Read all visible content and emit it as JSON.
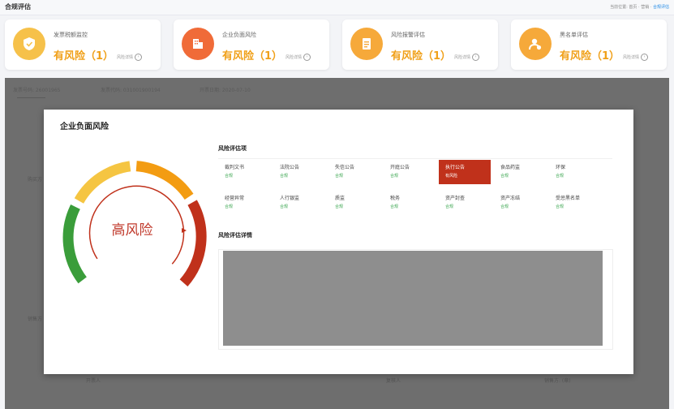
{
  "header": {
    "title": "合规评估",
    "breadcrumb": [
      "当前位置:",
      "首页",
      "·",
      "营销",
      "·",
      "合规评估"
    ]
  },
  "cards": [
    {
      "label": "发票税额监控",
      "status": "有风险（1）",
      "link": "风险详情",
      "color": "#f6c14a"
    },
    {
      "label": "企业负面风险",
      "status": "有风险（1）",
      "link": "风险详情",
      "color": "#f06b38"
    },
    {
      "label": "风险报警评估",
      "status": "有风险（1）",
      "link": "风险详情",
      "color": "#f6a93a"
    },
    {
      "label": "黑名单评估",
      "status": "有风险（1）",
      "link": "风险详情",
      "color": "#f6a93a"
    }
  ],
  "background": {
    "info1": "发票号码: 26001965",
    "info2": "发票代码: 031001900194",
    "info3": "开票日期: 2020-07-10",
    "side_a": "购买方",
    "side_b": "销售方",
    "row1": "开票人",
    "row2": "复核人",
    "row3": "销售方: (章)"
  },
  "modal": {
    "title": "企业负面风险",
    "gauge_label": "高风险",
    "section_items": "风险评估项",
    "section_detail": "风险评估详情",
    "items": [
      {
        "name": "裁判文书",
        "status": "合规",
        "risk": false
      },
      {
        "name": "法院公告",
        "status": "合规",
        "risk": false
      },
      {
        "name": "失信公告",
        "status": "合规",
        "risk": false
      },
      {
        "name": "开庭公告",
        "status": "合规",
        "risk": false
      },
      {
        "name": "执行公告",
        "status": "有风险",
        "risk": true
      },
      {
        "name": "食品药监",
        "status": "合规",
        "risk": false
      },
      {
        "name": "环保",
        "status": "合规",
        "risk": false
      },
      {
        "name": "经营异常",
        "status": "合规",
        "risk": false
      },
      {
        "name": "人行银监",
        "status": "合规",
        "risk": false
      },
      {
        "name": "质监",
        "status": "合规",
        "risk": false
      },
      {
        "name": "税务",
        "status": "合规",
        "risk": false
      },
      {
        "name": "资产封查",
        "status": "合规",
        "risk": false
      },
      {
        "name": "资产冻结",
        "status": "合规",
        "risk": false
      },
      {
        "name": "受惩黑名单",
        "status": "合规",
        "risk": false
      }
    ]
  },
  "colors": {
    "gauge_green": "#3a9d3a",
    "gauge_yellow": "#f5c542",
    "gauge_orange": "#f39c12",
    "gauge_red": "#c0311b",
    "risk_cell": "#c0311b",
    "ok_text": "#3aa64f"
  }
}
